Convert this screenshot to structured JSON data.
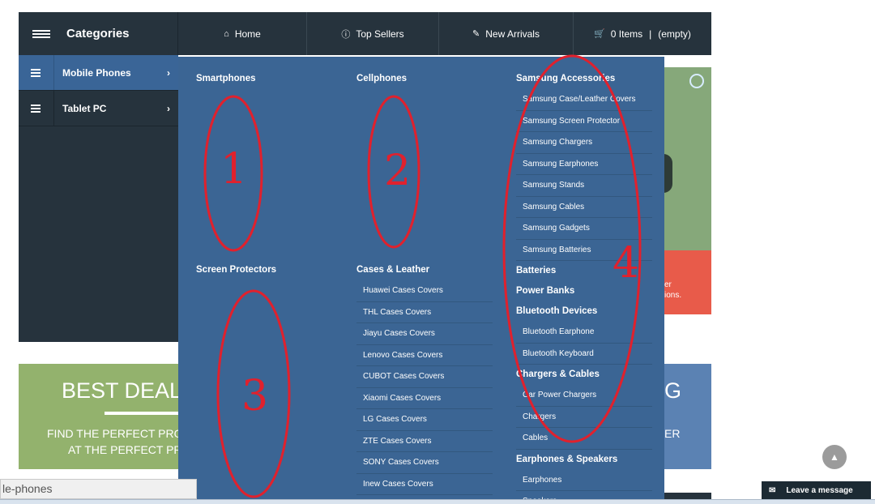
{
  "header": {
    "categories_title": "Categories",
    "nav": [
      {
        "icon": "home-icon",
        "label": "Home"
      },
      {
        "icon": "info-icon",
        "label": "Top Sellers"
      },
      {
        "icon": "edit-icon",
        "label": "New Arrivals"
      }
    ],
    "cart": {
      "icon": "cart-icon",
      "count_label": "0 Items",
      "separator": "|",
      "status": "(empty)"
    }
  },
  "sidebar": {
    "items": [
      {
        "label": "Mobile Phones",
        "active": true
      },
      {
        "label": "Tablet PC",
        "active": false
      }
    ]
  },
  "mega_menu": {
    "col1": {
      "heading1": "Smartphones",
      "heading2": "Screen Protectors"
    },
    "col2": {
      "heading1": "Cellphones",
      "heading2": "Cases & Leather",
      "items": [
        "Huawei Cases Covers",
        "THL Cases Covers",
        "Jiayu Cases Covers",
        "Lenovo Cases Covers",
        "CUBOT Cases Covers",
        "Xiaomi Cases Covers",
        "LG Cases Covers",
        "ZTE Cases Covers",
        "SONY Cases Covers",
        "Inew Cases Covers"
      ]
    },
    "col3": {
      "groups": [
        {
          "heading": "Samsung Accessories",
          "items": [
            "Samsung Case/Leather Covers",
            "Samsung Screen Protector",
            "Samsung Chargers",
            "Samsung Earphones",
            "Samsung Stands",
            "Samsung Cables",
            "Samsung Gadgets",
            "Samsung Batteries"
          ]
        },
        {
          "heading": "Batteries",
          "items": []
        },
        {
          "heading": "Power Banks",
          "items": []
        },
        {
          "heading": "Bluetooth Devices",
          "items": [
            "Bluetooth Earphone",
            "Bluetooth Keyboard"
          ]
        },
        {
          "heading": "Chargers & Cables",
          "items": [
            "Car Power Chargers",
            "Chargers",
            "Cables"
          ]
        },
        {
          "heading": "Earphones & Speakers",
          "items": [
            "Earphones",
            "Speakers"
          ]
        }
      ]
    }
  },
  "annotations": [
    "1",
    "2",
    "3",
    "4"
  ],
  "banners": {
    "left_title": "BEST DEAL",
    "left_line1": "FIND THE PERFECT PROD",
    "left_line2": "AT THE PERFECT PRIC",
    "right_title": "G",
    "right_line": "ER",
    "promo_line1": "er",
    "promo_line2": "ions."
  },
  "status_bar": {
    "url_fragment": "le-phones"
  },
  "chat": {
    "icon": "chat-icon",
    "label": "Leave a message"
  },
  "scroll_top": {
    "icon": "chevron-up-icon"
  },
  "colors": {
    "nav_bg": "#26333d",
    "menu_bg": "#3b6594",
    "active_item": "#3a6597",
    "annotation": "#e0212d"
  }
}
